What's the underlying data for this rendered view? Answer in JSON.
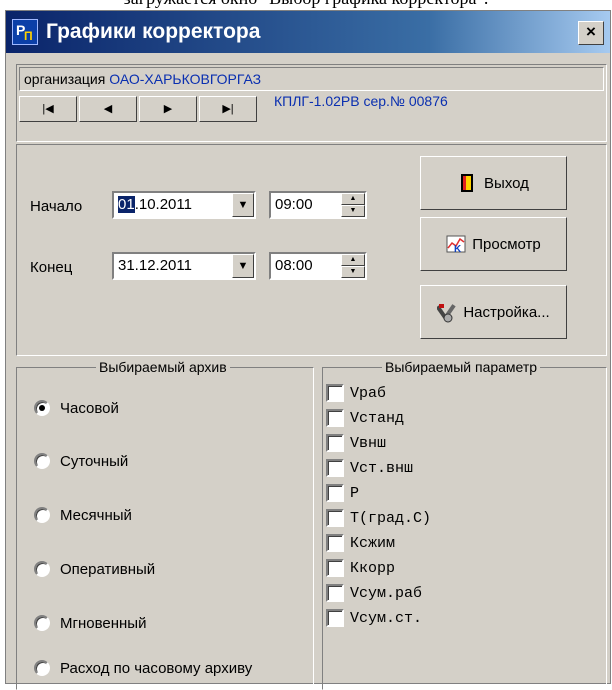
{
  "doc": {
    "caption_text": "загружается окно \"Выбор графика корректора\"."
  },
  "window": {
    "title": "Графики корректора",
    "close_label": "×"
  },
  "org": {
    "label": "организация",
    "value": "ОАО-ХАРЬКОВГОРГАЗ"
  },
  "nav": {
    "first": "◀",
    "prev": "◀",
    "next": "▶",
    "last": "▶"
  },
  "device": "КПЛГ-1.02РВ сер.№ 00876",
  "period": {
    "start_label": "Начало",
    "start_date_sel": "01",
    "start_date_rest": ".10.2011",
    "start_time": "09:00",
    "end_label": "Конец",
    "end_date": "31.12.2011",
    "end_time": "08:00"
  },
  "buttons": {
    "exit": "Выход",
    "view": "Просмотр",
    "settings": "Настройка..."
  },
  "archive": {
    "title": "Выбираемый архив",
    "options": [
      {
        "label": "Часовой",
        "selected": true
      },
      {
        "label": "Суточный",
        "selected": false
      },
      {
        "label": "Месячный",
        "selected": false
      },
      {
        "label": "Оперативный",
        "selected": false
      },
      {
        "label": "Мгновенный",
        "selected": false
      },
      {
        "label": "Расход по часовому архиву",
        "selected": false
      }
    ]
  },
  "params": {
    "title": "Выбираемый параметр",
    "items": [
      "Vраб",
      "Vстанд",
      "Vвнш",
      "Vст.внш",
      "P",
      "T(град.С)",
      "Ксжим",
      "Ккорр",
      "Vсум.раб",
      "Vсум.ст."
    ]
  }
}
